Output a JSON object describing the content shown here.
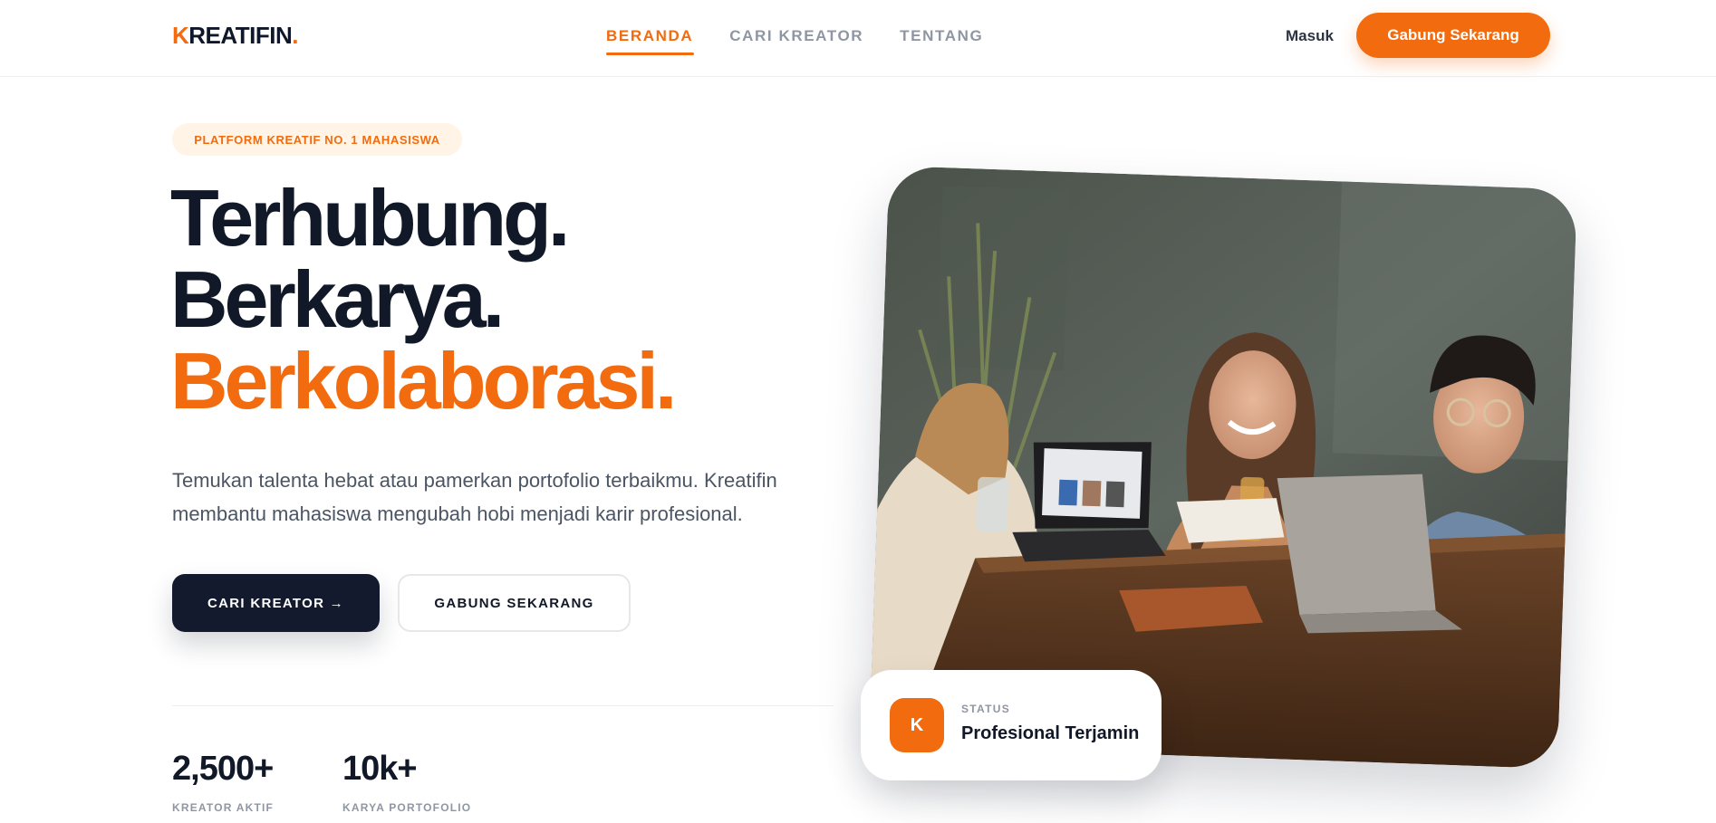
{
  "brand": {
    "logo_prefix": "K",
    "logo_rest": "REATIFIN",
    "logo_dot": ".",
    "accent_color": "#f26b0f",
    "dark_color": "#141a2e"
  },
  "nav": {
    "items": [
      {
        "label": "BERANDA",
        "active": true
      },
      {
        "label": "CARI KREATOR",
        "active": false
      },
      {
        "label": "TENTANG",
        "active": false
      }
    ]
  },
  "header": {
    "login_label": "Masuk",
    "join_label": "Gabung Sekarang"
  },
  "hero": {
    "badge": "PLATFORM KREATIF NO. 1 MAHASISWA",
    "headline_line1": "Terhubung.",
    "headline_line2": "Berkarya.",
    "headline_line3": "Berkolaborasi.",
    "description": "Temukan talenta hebat atau pamerkan portofolio terbaikmu. Kreatifin membantu mahasiswa mengubah hobi menjadi karir profesional.",
    "primary_button": "CARI KREATOR →",
    "secondary_button": "GABUNG SEKARANG"
  },
  "stats": [
    {
      "value": "2,500+",
      "label": "KREATOR AKTIF"
    },
    {
      "value": "10k+",
      "label": "KARYA PORTOFOLIO"
    }
  ],
  "status_card": {
    "icon_letter": "K",
    "label": "STATUS",
    "value": "Profesional Terjamin"
  }
}
